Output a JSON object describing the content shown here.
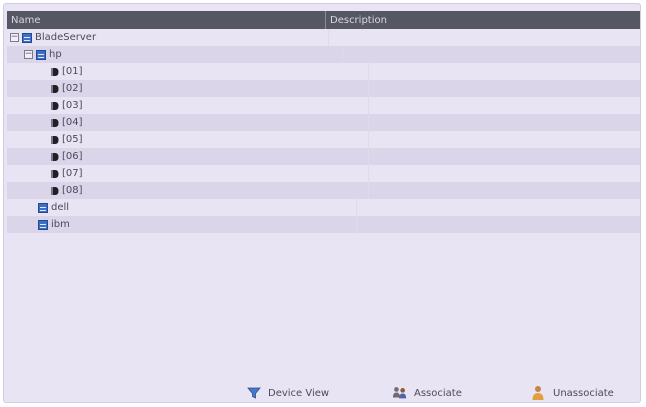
{
  "grid": {
    "columns": {
      "name": "Name",
      "description": "Description"
    },
    "rows": [
      {
        "label": "BladeServer",
        "kind": "group",
        "toggle": "−",
        "level": 0
      },
      {
        "label": "hp",
        "kind": "group",
        "toggle": "−",
        "level": 1
      },
      {
        "label": "[01]",
        "kind": "blade",
        "level": 2
      },
      {
        "label": "[02]",
        "kind": "blade",
        "level": 2
      },
      {
        "label": "[03]",
        "kind": "blade",
        "level": 2
      },
      {
        "label": "[04]",
        "kind": "blade",
        "level": 2
      },
      {
        "label": "[05]",
        "kind": "blade",
        "level": 2
      },
      {
        "label": "[06]",
        "kind": "blade",
        "level": 2
      },
      {
        "label": "[07]",
        "kind": "blade",
        "level": 2
      },
      {
        "label": "[08]",
        "kind": "blade",
        "level": 2
      },
      {
        "label": "dell",
        "kind": "group",
        "level": 1
      },
      {
        "label": "ibm",
        "kind": "group",
        "level": 1
      }
    ]
  },
  "toolbar": {
    "device_view": {
      "label": "Device View",
      "icon": "filter-icon"
    },
    "associate": {
      "label": "Associate",
      "icon": "users-link-icon"
    },
    "unassociate": {
      "label": "Unassociate",
      "icon": "user-icon"
    }
  },
  "colors": {
    "background": "#e9e4f3",
    "header": "#555763",
    "row_alt": "#dbd5ea",
    "node_icon": "#3c6fc6"
  }
}
